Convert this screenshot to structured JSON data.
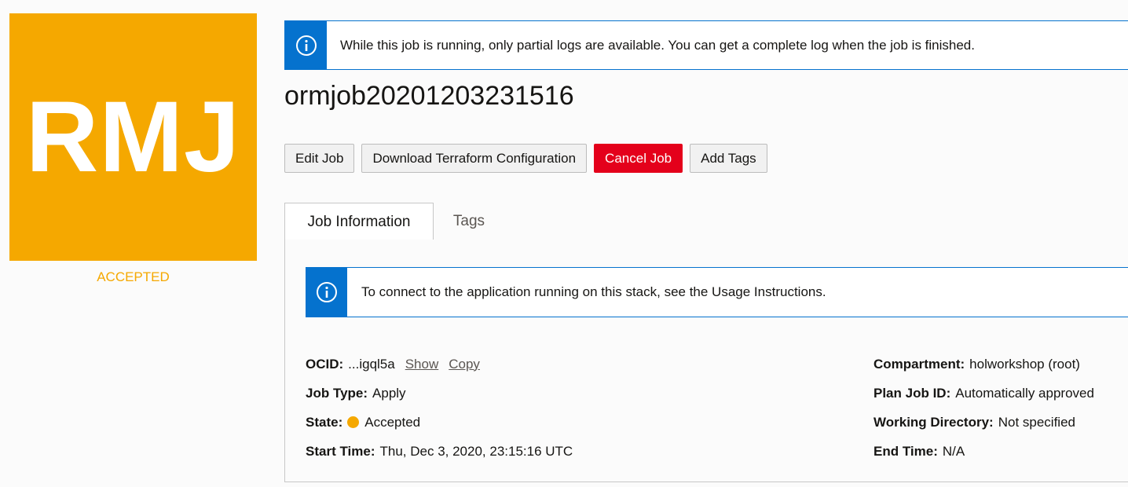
{
  "badge": {
    "text": "RMJ",
    "state": "ACCEPTED",
    "color": "#f5a800"
  },
  "banner": {
    "message": "While this job is running, only partial logs are available. You can get a complete log when the job is finished.",
    "icon": "info-icon"
  },
  "title": "ormjob20201203231516",
  "buttons": {
    "edit": "Edit Job",
    "download": "Download Terraform Configuration",
    "cancel": "Cancel Job",
    "tags": "Add Tags"
  },
  "tabs": [
    {
      "label": "Job Information",
      "active": true
    },
    {
      "label": "Tags",
      "active": false
    }
  ],
  "panel": {
    "banner_message": "To connect to the application running on this stack, see the Usage Instructions.",
    "left": {
      "ocid_label": "OCID:",
      "ocid_value": "...igql5a",
      "show": "Show",
      "copy": "Copy",
      "job_type_label": "Job Type:",
      "job_type_value": "Apply",
      "state_label": "State:",
      "state_value": "Accepted",
      "start_label": "Start Time:",
      "start_value": "Thu, Dec 3, 2020, 23:15:16 UTC"
    },
    "right": {
      "compartment_label": "Compartment:",
      "compartment_value": "holworkshop (root)",
      "plan_label": "Plan Job ID:",
      "plan_value": "Automatically approved",
      "wd_label": "Working Directory:",
      "wd_value": "Not specified",
      "end_label": "End Time:",
      "end_value": "N/A"
    }
  },
  "colors": {
    "accent": "#0572ce",
    "danger": "#e4001b",
    "accepted": "#f5a800"
  }
}
